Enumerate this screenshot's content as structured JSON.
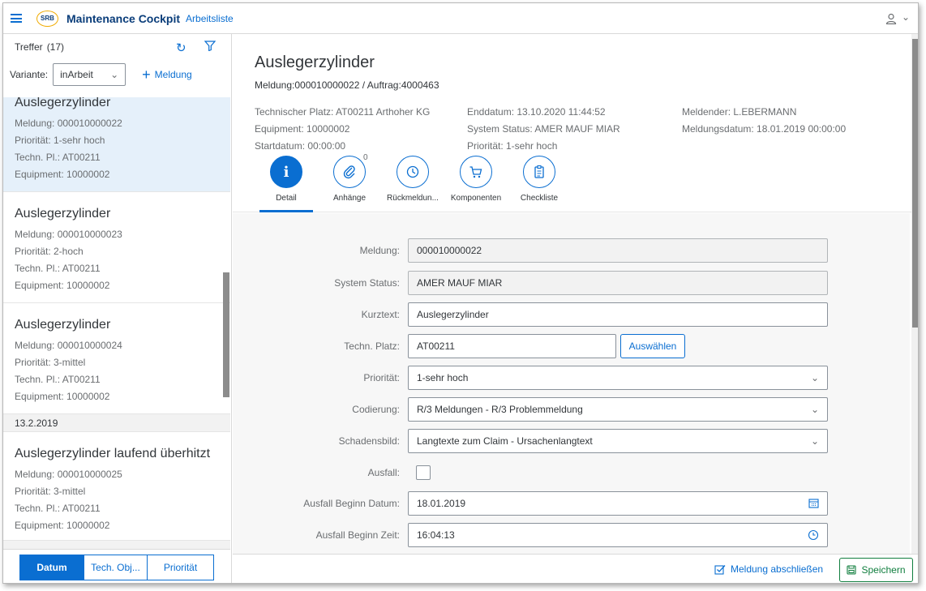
{
  "shell": {
    "app_title": "Maintenance Cockpit",
    "app_subtitle": "Arbeitsliste",
    "logo_text": "SRB",
    "user_chevron": "⌄"
  },
  "master": {
    "hits_label": "Treffer",
    "hits_count": "(17)",
    "variant_label": "Variante:",
    "variant_value": "inArbeit",
    "add_label": "Meldung",
    "items": [
      {
        "title": "Auslegerzylinder",
        "meldung": "Meldung: 000010000022",
        "prio": "Priorität: 1-sehr hoch",
        "techn": "Techn. Pl.: AT00211",
        "equip": "Equipment: 10000002"
      },
      {
        "title": "Auslegerzylinder",
        "meldung": "Meldung: 000010000023",
        "prio": "Priorität: 2-hoch",
        "techn": "Techn. Pl.: AT00211",
        "equip": "Equipment: 10000002"
      },
      {
        "title": "Auslegerzylinder",
        "meldung": "Meldung: 000010000024",
        "prio": "Priorität: 3-mittel",
        "techn": "Techn. Pl.: AT00211",
        "equip": "Equipment: 10000002"
      },
      {
        "title": "Auslegerzylinder laufend überhitzt",
        "meldung": "Meldung: 000010000025",
        "prio": "Priorität: 3-mittel",
        "techn": "Techn. Pl.: AT00211",
        "equip": "Equipment: 10000002"
      }
    ],
    "group_date": "13.2.2019",
    "footer": {
      "datum": "Datum",
      "tech_obj": "Tech. Obj...",
      "prioritaet": "Priorität"
    }
  },
  "detail": {
    "title": "Auslegerzylinder",
    "subtitle": "Meldung:000010000022 / Auftrag:4000463",
    "attrs_col1": [
      "Technischer Platz: AT00211 Arthoher KG",
      "Equipment: 10000002",
      "Startdatum:  00:00:00"
    ],
    "attrs_col2": [
      "Enddatum: 13.10.2020 11:44:52",
      "System Status: AMER MAUF MIAR",
      "Priorität: 1-sehr hoch"
    ],
    "attrs_col3": [
      "Meldender: L.EBERMANN",
      "Meldungsdatum: 18.01.2019 00:00:00"
    ],
    "tabs": {
      "detail": "Detail",
      "anhaenge": "Anhänge",
      "anhaenge_count": "0",
      "rueckmeldung": "Rückmeldun...",
      "komponenten": "Komponenten",
      "checkliste": "Checkliste"
    },
    "form": {
      "meldung_label": "Meldung:",
      "meldung_value": "000010000022",
      "status_label": "System Status:",
      "status_value": "AMER MAUF MIAR",
      "kurztext_label": "Kurztext:",
      "kurztext_value": "Auslegerzylinder",
      "techn_label": "Techn. Platz:",
      "techn_value": "AT00211",
      "techn_button": "Auswählen",
      "prio_label": "Priorität:",
      "prio_value": "1-sehr hoch",
      "codierung_label": "Codierung:",
      "codierung_value": "R/3 Meldungen - R/3 Problemmeldung",
      "schaden_label": "Schadensbild:",
      "schaden_value": "Langtexte zum Claim - Ursachenlangtext",
      "ausfall_label": "Ausfall:",
      "beginn_datum_label": "Ausfall Beginn Datum:",
      "beginn_datum_value": "18.01.2019",
      "beginn_zeit_label": "Ausfall Beginn Zeit:",
      "beginn_zeit_value": "16:04:13"
    },
    "footer": {
      "close_label": "Meldung abschließen",
      "save_label": "Speichern"
    }
  },
  "colors": {
    "accent": "#0a6ed1",
    "positive": "#107e3e",
    "selection": "#e5f0fa"
  }
}
